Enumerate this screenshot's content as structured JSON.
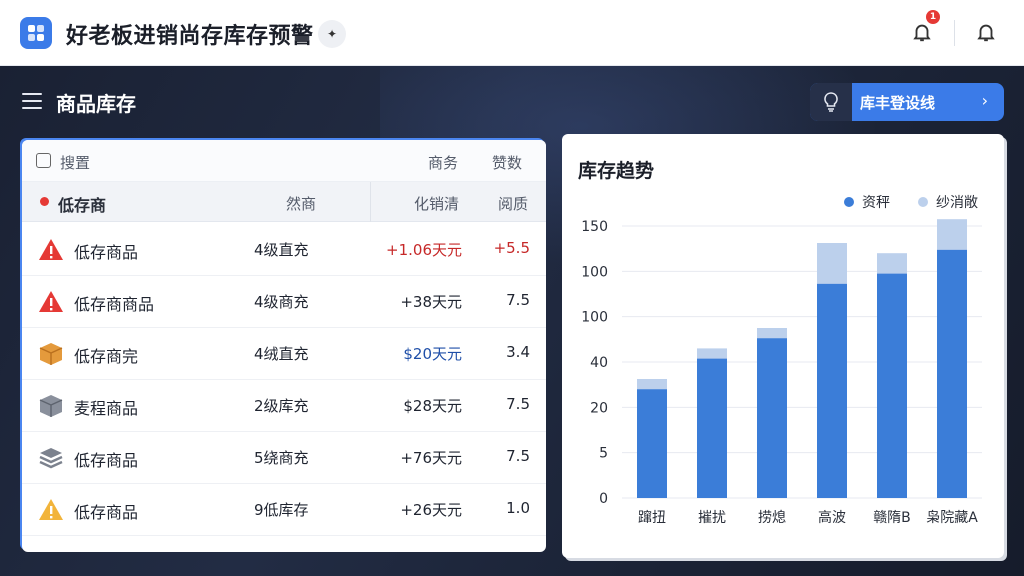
{
  "app": {
    "title": "好老板进销尚存库存预警",
    "sparkle": "✦",
    "notification_count": "1"
  },
  "page": {
    "title": "商品库存",
    "settings_button": "库丰登设线"
  },
  "table": {
    "filter_label": "搜置",
    "filter_cols": [
      "商务",
      "赞数"
    ],
    "sub_label": "低存商",
    "sub_cols": [
      "然商",
      "化销清",
      "阅质"
    ],
    "rows": [
      {
        "icon": "warning-red-icon",
        "name": "低存商品",
        "supplier": "4级直充",
        "amount": "+1.06天元",
        "qty": "+5.5",
        "amount_color": "red",
        "qty_color": "red"
      },
      {
        "icon": "warning-red-icon",
        "name": "低存商商品",
        "supplier": "4级商充",
        "amount": "+38天元",
        "qty": "7.5",
        "amount_color": "",
        "qty_color": ""
      },
      {
        "icon": "box-orange-icon",
        "name": "低存商完",
        "supplier": "4绒直充",
        "amount": "$20天元",
        "qty": "3.4",
        "amount_color": "blue",
        "qty_color": ""
      },
      {
        "icon": "cube-gray-icon",
        "name": "麦程商品",
        "supplier": "2级库充",
        "amount": "$28天元",
        "qty": "7.5",
        "amount_color": "",
        "qty_color": ""
      },
      {
        "icon": "layers-gray-icon",
        "name": "低存商品",
        "supplier": "5绕商充",
        "amount": "+76天元",
        "qty": "7.5",
        "amount_color": "",
        "qty_color": ""
      },
      {
        "icon": "warning-yellow-icon",
        "name": "低存商品",
        "supplier": "9低库存",
        "amount": "+26天元",
        "qty": "1.0",
        "amount_color": "",
        "qty_color": ""
      }
    ]
  },
  "chart_data": {
    "type": "bar",
    "title": "库存趋势",
    "categories": [
      "蹿扭",
      "摧扰",
      "捞熄",
      "高波",
      "赣隋B",
      "枭院藏A"
    ],
    "ytick_labels": [
      "150",
      "100",
      "100",
      "40",
      "20",
      "5",
      "0"
    ],
    "series": [
      {
        "name": "资秤",
        "color": "#3b7dd8",
        "values": [
          32,
          41,
          47,
          63,
          66,
          73
        ]
      },
      {
        "name": "纱消敞",
        "color": "#bcd0ec",
        "values": [
          3,
          3,
          3,
          12,
          6,
          9
        ]
      }
    ],
    "ylim": [
      0,
      80
    ]
  },
  "colors": {
    "accent": "#3b7be8",
    "dark_bg": "#1c2436",
    "danger": "#c62828"
  }
}
